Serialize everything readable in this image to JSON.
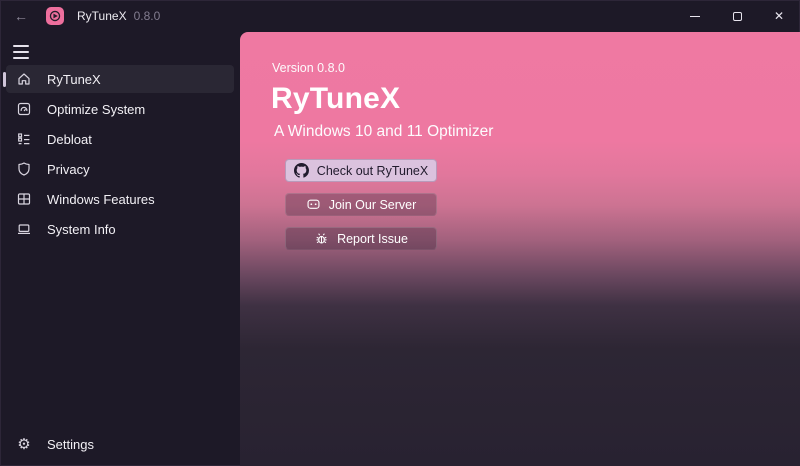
{
  "titlebar": {
    "back_icon": "←",
    "app_name": "RyTuneX",
    "app_version": "0.8.0",
    "close_icon": "✕"
  },
  "sidebar": {
    "items": [
      {
        "label": "RyTuneX",
        "icon": "home-icon",
        "selected": true
      },
      {
        "label": "Optimize System",
        "icon": "optimize-gauge-icon",
        "selected": false
      },
      {
        "label": "Debloat",
        "icon": "debloat-list-icon",
        "selected": false
      },
      {
        "label": "Privacy",
        "icon": "shield-icon",
        "selected": false
      },
      {
        "label": "Windows Features",
        "icon": "windows-grid-icon",
        "selected": false
      },
      {
        "label": "System Info",
        "icon": "laptop-icon",
        "selected": false
      }
    ],
    "settings": {
      "label": "Settings",
      "icon": "gear-icon",
      "gear_glyph": "⚙"
    }
  },
  "hero": {
    "version_label": "Version 0.8.0",
    "title": "RyTuneX",
    "subtitle": "A Windows 10 and 11 Optimizer",
    "buttons": [
      {
        "label": "Check out RyTuneX",
        "icon": "github-icon",
        "style": "accent"
      },
      {
        "label": "Join Our Server",
        "icon": "discord-icon",
        "style": "subtle"
      },
      {
        "label": "Report Issue",
        "icon": "bug-icon",
        "style": "subtle"
      }
    ]
  },
  "colors": {
    "accent_pink": "#ef79a2",
    "window_bg": "#1d1927",
    "content_bottom": "#282231",
    "selected_item_bg": "#2a2734",
    "accent_button_bg": "#dbc2de",
    "app_icon_bg": "#ee6f9d"
  }
}
